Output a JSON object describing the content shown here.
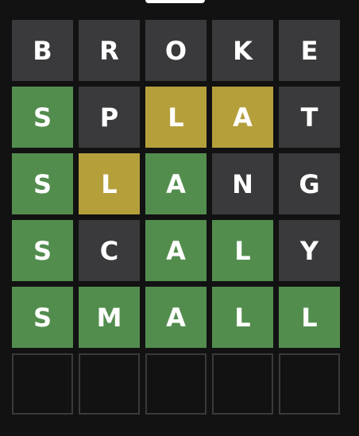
{
  "colors": {
    "background": "#121213",
    "absent": "#3a3a3c",
    "present": "#b59f3b",
    "correct": "#538d4e",
    "empty_border": "#3a3a3c",
    "letter": "#ffffff"
  },
  "board": {
    "rows": [
      {
        "tiles": [
          {
            "letter": "B",
            "state": "absent"
          },
          {
            "letter": "R",
            "state": "absent"
          },
          {
            "letter": "O",
            "state": "absent"
          },
          {
            "letter": "K",
            "state": "absent"
          },
          {
            "letter": "E",
            "state": "absent"
          }
        ]
      },
      {
        "tiles": [
          {
            "letter": "S",
            "state": "correct"
          },
          {
            "letter": "P",
            "state": "absent"
          },
          {
            "letter": "L",
            "state": "present"
          },
          {
            "letter": "A",
            "state": "present"
          },
          {
            "letter": "T",
            "state": "absent"
          }
        ]
      },
      {
        "tiles": [
          {
            "letter": "S",
            "state": "correct"
          },
          {
            "letter": "L",
            "state": "present"
          },
          {
            "letter": "A",
            "state": "correct"
          },
          {
            "letter": "N",
            "state": "absent"
          },
          {
            "letter": "G",
            "state": "absent"
          }
        ]
      },
      {
        "tiles": [
          {
            "letter": "S",
            "state": "correct"
          },
          {
            "letter": "C",
            "state": "absent"
          },
          {
            "letter": "A",
            "state": "correct"
          },
          {
            "letter": "L",
            "state": "correct"
          },
          {
            "letter": "Y",
            "state": "absent"
          }
        ]
      },
      {
        "tiles": [
          {
            "letter": "S",
            "state": "correct"
          },
          {
            "letter": "M",
            "state": "correct"
          },
          {
            "letter": "A",
            "state": "correct"
          },
          {
            "letter": "L",
            "state": "correct"
          },
          {
            "letter": "L",
            "state": "correct"
          }
        ]
      },
      {
        "tiles": [
          {
            "letter": "",
            "state": "empty"
          },
          {
            "letter": "",
            "state": "empty"
          },
          {
            "letter": "",
            "state": "empty"
          },
          {
            "letter": "",
            "state": "empty"
          },
          {
            "letter": "",
            "state": "empty"
          }
        ]
      }
    ]
  }
}
